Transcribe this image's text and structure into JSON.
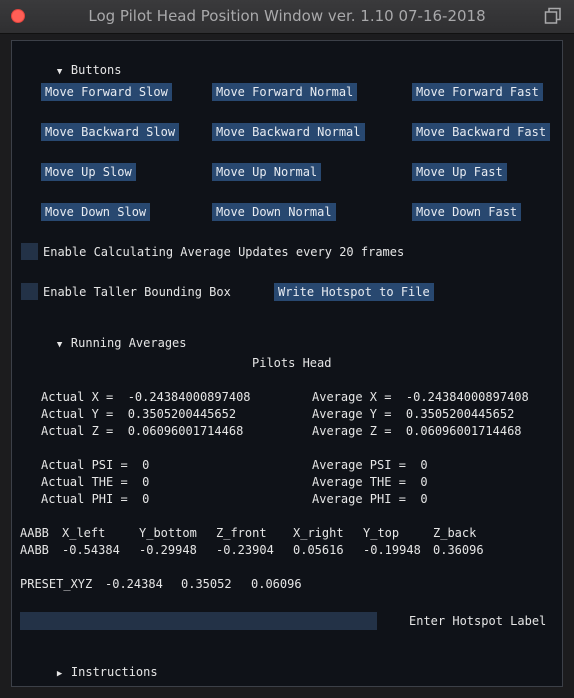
{
  "window": {
    "title": "Log Pilot Head Position Window ver. 1.10  07-16-2018"
  },
  "buttons_section": {
    "header": "Buttons",
    "rows": [
      [
        "Move Forward Slow",
        "Move Forward Normal",
        "Move Forward Fast"
      ],
      [
        "Move Backward Slow",
        "Move Backward Normal",
        "Move Backward Fast"
      ],
      [
        "Move Up Slow",
        "Move Up Normal",
        "Move Up Fast"
      ],
      [
        "Move Down Slow",
        "Move Down Normal",
        "Move Down Fast"
      ]
    ],
    "avg_checkbox_label": "Enable Calculating Average Updates every 20 frames",
    "avg_checkbox_checked": false,
    "taller_checkbox_label": "Enable Taller Bounding Box",
    "taller_checkbox_checked": false,
    "write_hotspot_label": "Write Hotspot to File"
  },
  "running_averages": {
    "header": "Running Averages",
    "subtitle": "Pilots Head",
    "actual": [
      "Actual X =  -0.24384000897408",
      "Actual Y =  0.3505200445652",
      "Actual Z =  0.06096001714468",
      "Actual PSI =  0",
      "Actual THE =  0",
      "Actual PHI =  0"
    ],
    "average": [
      "Average X =  -0.24384000897408",
      "Average Y =  0.3505200445652",
      "Average Z =  0.06096001714468",
      "Average PSI =  0",
      "Average THE =  0",
      "Average PHI =  0"
    ],
    "aabb_header": [
      "AABB",
      "X_left",
      "Y_bottom",
      "Z_front",
      "X_right",
      "Y_top",
      "Z_back"
    ],
    "aabb_values": [
      "AABB",
      "-0.54384",
      "-0.29948",
      "-0.23904",
      "0.05616",
      "-0.19948",
      "0.36096"
    ],
    "preset": [
      "PRESET_XYZ",
      "-0.24384",
      "0.35052",
      "0.06096"
    ]
  },
  "hotspot": {
    "input_value": "",
    "label": "Enter Hotspot Label"
  },
  "instructions": {
    "header": "Instructions"
  },
  "colors": {
    "button_bg": "#284870",
    "checkbox_bg": "#233247",
    "panel_bg": "#0f1218"
  }
}
